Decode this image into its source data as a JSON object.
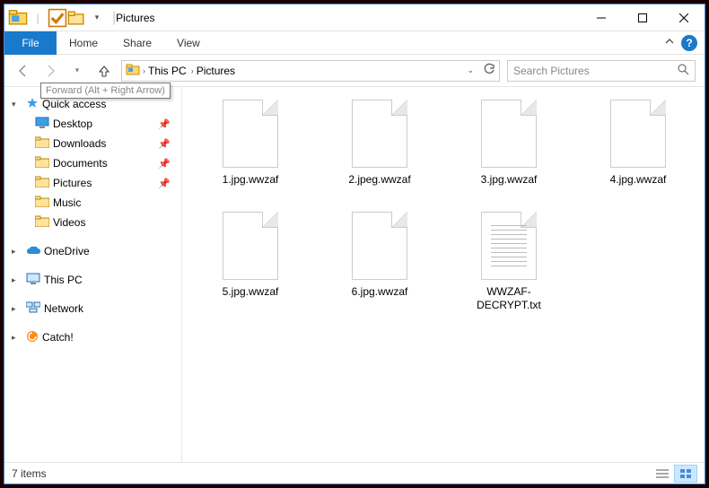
{
  "window": {
    "title": "Pictures"
  },
  "ribbon": {
    "file": "File",
    "tabs": [
      "Home",
      "Share",
      "View"
    ]
  },
  "nav": {
    "tooltip": "Forward (Alt + Right Arrow)"
  },
  "address": {
    "crumbs": [
      "This PC",
      "Pictures"
    ]
  },
  "search": {
    "placeholder": "Search Pictures"
  },
  "sidebar": {
    "quick_access": "Quick access",
    "quick_items": [
      {
        "label": "Desktop",
        "pinned": true,
        "icon": "desktop"
      },
      {
        "label": "Downloads",
        "pinned": true,
        "icon": "downloads"
      },
      {
        "label": "Documents",
        "pinned": true,
        "icon": "documents"
      },
      {
        "label": "Pictures",
        "pinned": true,
        "icon": "pictures"
      },
      {
        "label": "Music",
        "pinned": false,
        "icon": "music"
      },
      {
        "label": "Videos",
        "pinned": false,
        "icon": "videos"
      }
    ],
    "roots": [
      {
        "label": "OneDrive",
        "icon": "onedrive"
      },
      {
        "label": "This PC",
        "icon": "thispc"
      },
      {
        "label": "Network",
        "icon": "network"
      },
      {
        "label": "Catch!",
        "icon": "catch"
      }
    ]
  },
  "files": [
    {
      "name": "1.jpg.wwzaf",
      "kind": "generic"
    },
    {
      "name": "2.jpeg.wwzaf",
      "kind": "generic"
    },
    {
      "name": "3.jpg.wwzaf",
      "kind": "generic"
    },
    {
      "name": "4.jpg.wwzaf",
      "kind": "generic"
    },
    {
      "name": "5.jpg.wwzaf",
      "kind": "generic"
    },
    {
      "name": "6.jpg.wwzaf",
      "kind": "generic"
    },
    {
      "name": "WWZAF-DECRYPT.txt",
      "kind": "text"
    }
  ],
  "status": {
    "count_label": "7 items"
  }
}
